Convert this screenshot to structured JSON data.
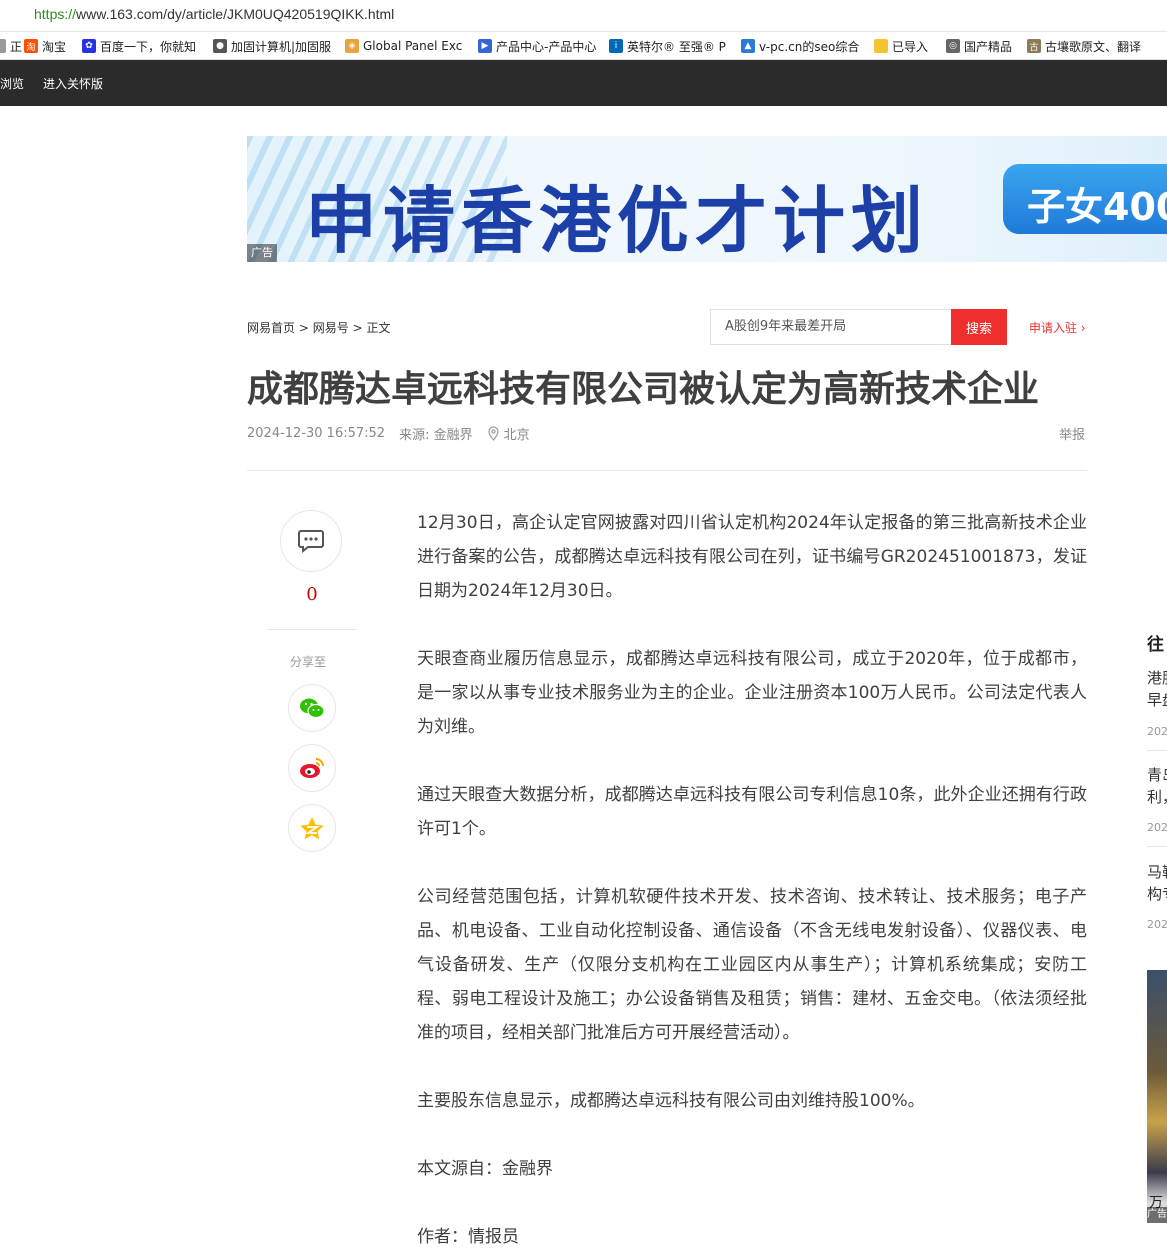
{
  "browser": {
    "url_protocol": "https://",
    "url_rest": "www.163.com/dy/article/JKM0UQ420519QIKK.html",
    "bookmarks": [
      {
        "label": "正",
        "icon": "page-icon",
        "color": "#999999"
      },
      {
        "label": "淘宝",
        "icon": "taobao-icon",
        "color": "#ff5000"
      },
      {
        "label": "百度一下，你就知",
        "icon": "baidu-icon",
        "color": "#2932e1"
      },
      {
        "label": "加固计算机|加固服",
        "icon": "site-icon",
        "color": "#555555"
      },
      {
        "label": "Global Panel Exc",
        "icon": "global-panel-icon",
        "color": "#e8a33c"
      },
      {
        "label": "产品中心-产品中心",
        "icon": "flag-icon",
        "color": "#3367d6"
      },
      {
        "label": "英特尔® 至强® P",
        "icon": "intel-icon",
        "color": "#0068b5"
      },
      {
        "label": "v-pc.cn的seo综合",
        "icon": "chart-icon",
        "color": "#2a7bd6"
      },
      {
        "label": "已导入",
        "icon": "folder-icon",
        "color": "#f4c430"
      },
      {
        "label": "国产精品",
        "icon": "globe-icon",
        "color": "#666666"
      },
      {
        "label": "古壤歌原文、翻译",
        "icon": "gu-icon",
        "color": "#8a7a55"
      }
    ],
    "toolbar": {
      "item1": "浏览",
      "item2": "进入关怀版"
    }
  },
  "ad_banner": {
    "headline": "申请香港优才计划",
    "bubble": "子女400",
    "tag": "广告"
  },
  "breadcrumb": {
    "home": "网易首页",
    "sep": ">",
    "section": "网易号",
    "current": "正文"
  },
  "search": {
    "placeholder": "A股创9年来最差开局",
    "button": "搜索"
  },
  "apply_link": "申请入驻 ›",
  "article": {
    "title": "成都腾达卓远科技有限公司被认定为高新技术企业",
    "datetime": "2024-12-30 16:57:52",
    "source": "来源: 金融界",
    "location": "北京",
    "report": "举报",
    "paragraphs": [
      "12月30日，高企认定官网披露对四川省认定机构2024年认定报备的第三批高新技术企业进行备案的公告，成都腾达卓远科技有限公司在列，证书编号GR202451001873，发证日期为2024年12月30日。",
      "天眼查商业履历信息显示，成都腾达卓远科技有限公司，成立于2020年，位于成都市，是一家以从事专业技术服务业为主的企业。企业注册资本100万人民币。公司法定代表人为刘维。",
      "通过天眼查大数据分析，成都腾达卓远科技有限公司专利信息10条，此外企业还拥有行政许可1个。",
      "公司经营范围包括，计算机软硬件技术开发、技术咨询、技术转让、技术服务；电子产品、机电设备、工业自动化控制设备、通信设备（不含无线电发射设备）、仪器仪表、电气设备研发、生产（仅限分支机构在工业园区内从事生产）；计算机系统集成；安防工程、弱电工程设计及施工；办公设备销售及租赁；销售：建材、五金交电。（依法须经批准的项目，经相关部门批准后方可开展经营活动）。",
      "主要股东信息显示，成都腾达卓远科技有限公司由刘维持股100%。",
      "本文源自：金融界",
      "作者：情报员"
    ]
  },
  "rail": {
    "comment_count": "0",
    "share_label": "分享至"
  },
  "sidebar": {
    "title": "往",
    "items": [
      {
        "line1": "港股",
        "line2": "早盘",
        "date": "202"
      },
      {
        "line1": "青岛",
        "line2": "利，",
        "date": "202"
      },
      {
        "line1": "马勒",
        "line2": "构专",
        "date": "202"
      }
    ],
    "ad_text": "万",
    "ad_tag": "广告"
  }
}
